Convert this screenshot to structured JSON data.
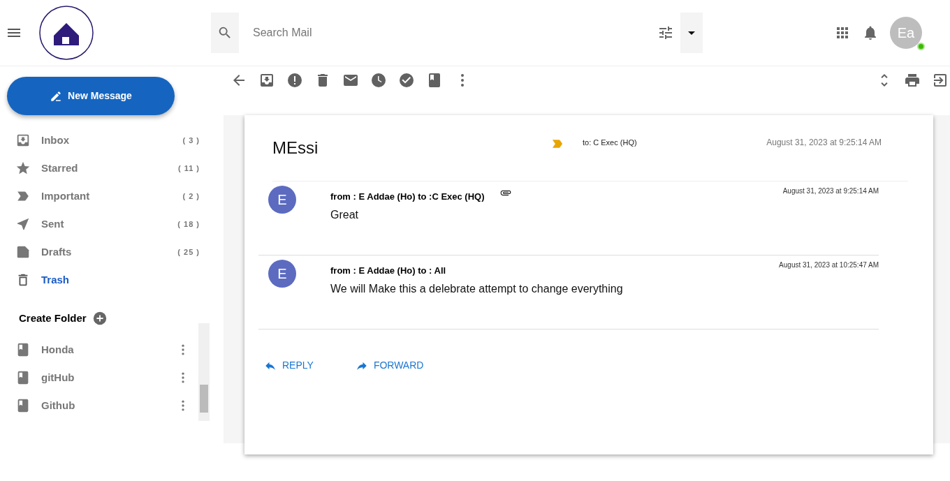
{
  "header": {
    "search": {
      "placeholder": "Search Mail"
    },
    "avatar": {
      "initials": "Ea",
      "online": true
    }
  },
  "compose_button": "New Message",
  "sidebar": {
    "items": [
      {
        "kind": "inbox",
        "label": "Inbox",
        "count": "( 3 )",
        "selected": false
      },
      {
        "kind": "star",
        "label": "Starred",
        "count": "( 11 )",
        "selected": false
      },
      {
        "kind": "important",
        "label": "Important",
        "count": "( 2 )",
        "selected": false
      },
      {
        "kind": "sent",
        "label": "Sent",
        "count": "( 18 )",
        "selected": false
      },
      {
        "kind": "drafts",
        "label": "Drafts",
        "count": "( 25 )",
        "selected": false
      },
      {
        "kind": "trash",
        "label": "Trash",
        "selected": true
      }
    ],
    "create_folder": "Create Folder",
    "folders": [
      "Honda",
      "gitHub",
      "Github"
    ]
  },
  "thread": {
    "subject": "MEssi",
    "important": true,
    "to": "to:  C Exec (HQ)",
    "date": "August 31, 2023 at 9:25:14 AM",
    "messages": [
      {
        "initial": "E",
        "header": "from : E Addae (Ho) to :C Exec (HQ)",
        "attachment": true,
        "date": "August 31, 2023 at 9:25:14 AM",
        "body": "Great"
      },
      {
        "initial": "E",
        "header": "from : E Addae (Ho) to : All",
        "attachment": false,
        "date": "August 31, 2023 at 10:25:47 AM",
        "body": "We will Make this a delebrate attempt to change everything"
      }
    ],
    "actions": [
      {
        "kind": "reply",
        "label": "REPLY"
      },
      {
        "kind": "forward",
        "label": "FORWARD"
      }
    ]
  }
}
